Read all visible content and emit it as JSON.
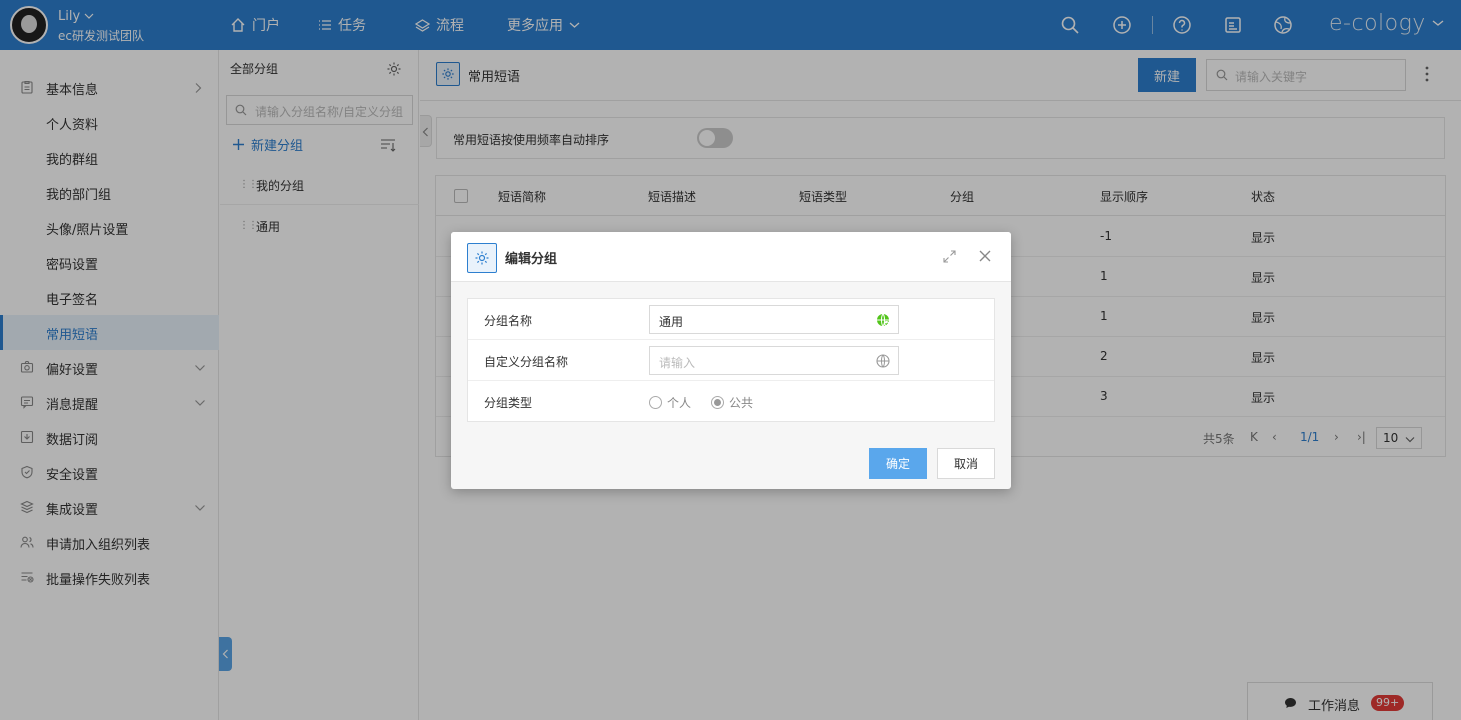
{
  "user": {
    "name": "Lily",
    "team": "ec研发测试团队"
  },
  "topnav": [
    {
      "label": "门户",
      "icon": "home-icon"
    },
    {
      "label": "任务",
      "icon": "list-icon"
    },
    {
      "label": "流程",
      "icon": "layers-icon"
    },
    {
      "label": "更多应用",
      "icon": "chevron-down-icon"
    }
  ],
  "brand": "e-cology",
  "sidebar": {
    "items": [
      {
        "label": "基本信息",
        "icon": "clipboard-icon",
        "chevron": "right"
      },
      {
        "label": "个人资料"
      },
      {
        "label": "我的群组"
      },
      {
        "label": "我的部门组"
      },
      {
        "label": "头像/照片设置"
      },
      {
        "label": "密码设置"
      },
      {
        "label": "电子签名"
      },
      {
        "label": "常用短语",
        "active": true
      },
      {
        "label": "偏好设置",
        "icon": "camera-icon",
        "chevron": "down"
      },
      {
        "label": "消息提醒",
        "icon": "message-icon",
        "chevron": "down"
      },
      {
        "label": "数据订阅",
        "icon": "subscribe-icon"
      },
      {
        "label": "安全设置",
        "icon": "shield-icon"
      },
      {
        "label": "集成设置",
        "icon": "stack-icon",
        "chevron": "down"
      },
      {
        "label": "申请加入组织列表",
        "icon": "users-icon"
      },
      {
        "label": "批量操作失败列表",
        "icon": "list-fail-icon"
      }
    ]
  },
  "groups": {
    "title": "全部分组",
    "search_placeholder": "请输入分组名称/自定义分组",
    "new_label": "新建分组",
    "items": [
      "我的分组",
      "通用"
    ]
  },
  "main": {
    "title": "常用短语",
    "new_button": "新建",
    "search_placeholder": "请输入关键字",
    "auto_sort_label": "常用短语按使用频率自动排序",
    "auto_sort_on": false,
    "columns": [
      "短语简称",
      "短语描述",
      "短语类型",
      "分组",
      "显示顺序",
      "状态"
    ],
    "rows": [
      {
        "order": "-1",
        "status": "显示"
      },
      {
        "order": "1",
        "status": "显示"
      },
      {
        "order": "1",
        "status": "显示"
      },
      {
        "order": "2",
        "status": "显示"
      },
      {
        "order": "3",
        "status": "显示"
      }
    ],
    "pager": {
      "total": "共5条",
      "page": "1/1",
      "size": "10"
    }
  },
  "dock": {
    "label": "工作消息",
    "badge": "99+"
  },
  "modal": {
    "title": "编辑分组",
    "fields": {
      "name_label": "分组名称",
      "name_value": "通用",
      "custom_label": "自定义分组名称",
      "custom_placeholder": "请输入",
      "type_label": "分组类型",
      "type_options": [
        "个人",
        "公共"
      ],
      "type_selected": "公共"
    },
    "ok": "确定",
    "cancel": "取消"
  },
  "colors": {
    "accent": "#2d7fcf",
    "header": "#2d7fcf",
    "badge": "#e23c39",
    "ok_button": "#5aa7ec"
  }
}
